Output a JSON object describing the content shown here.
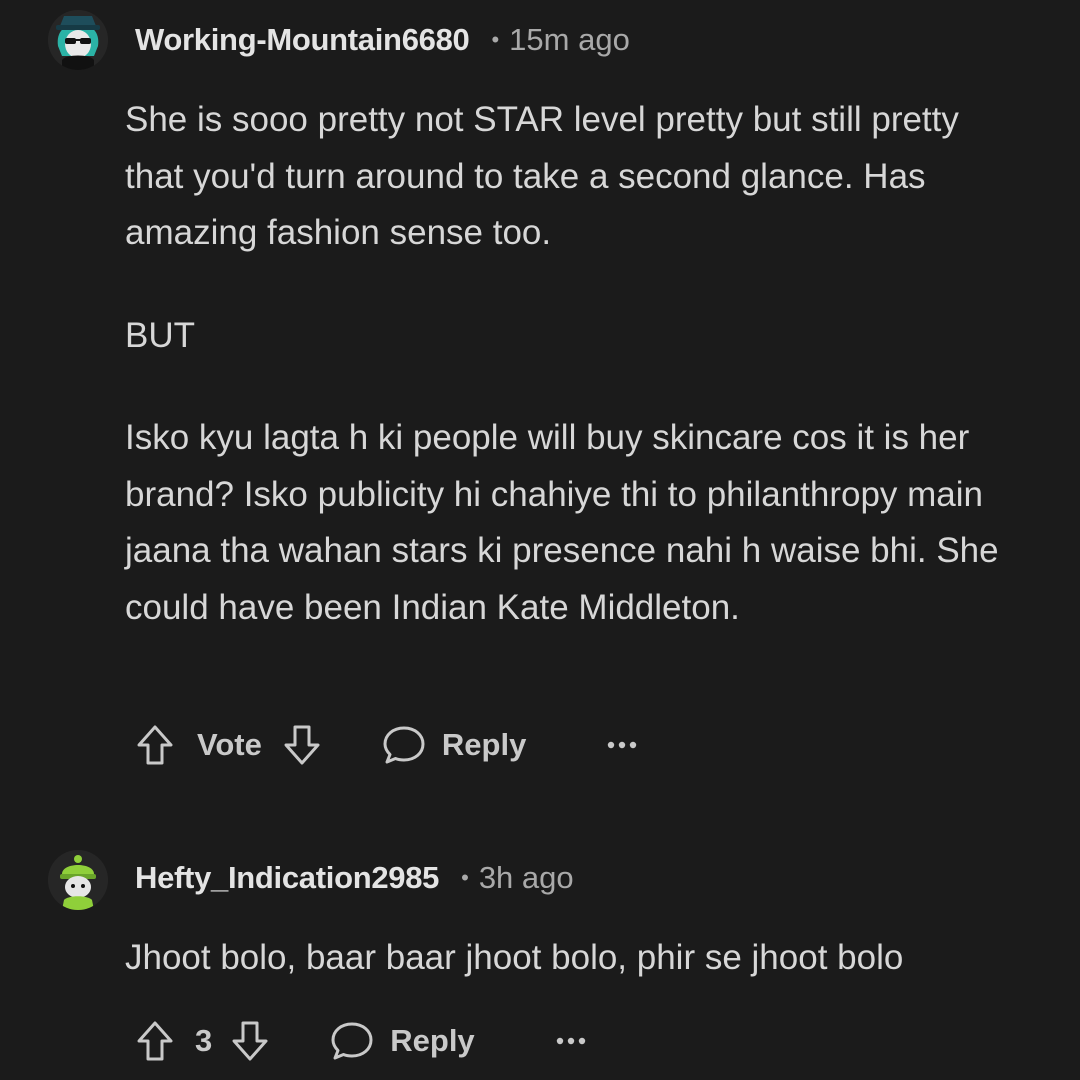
{
  "comments": [
    {
      "username": "Working-Mountain6680",
      "separator": "•",
      "timestamp": "15m ago",
      "avatar_icon": "avatar-teal-hair-sunglasses-icon",
      "body": [
        "She is sooo pretty not STAR level pretty but still pretty that you'd turn around to take a second glance. Has amazing fashion sense too.",
        "BUT",
        "Isko kyu lagta h ki people will buy skincare cos it is her brand? Isko publicity hi chahiye thi to philanthropy main jaana tha wahan stars ki presence nahi h waise bhi. She could have been Indian Kate Middleton."
      ],
      "vote_label": "Vote",
      "reply_label": "Reply",
      "more_icon": "more-options-icon"
    },
    {
      "username": "Hefty_Indication2985",
      "separator": "•",
      "timestamp": "3h ago",
      "avatar_icon": "avatar-green-beanie-icon",
      "body": [
        "Jhoot bolo, baar baar jhoot bolo, phir se jhoot bolo"
      ],
      "vote_count": "3",
      "reply_label": "Reply",
      "more_icon": "more-options-icon"
    }
  ],
  "colors": {
    "background": "#1b1b1b",
    "text": "#d7d7d7",
    "muted": "#a9a9a9"
  }
}
